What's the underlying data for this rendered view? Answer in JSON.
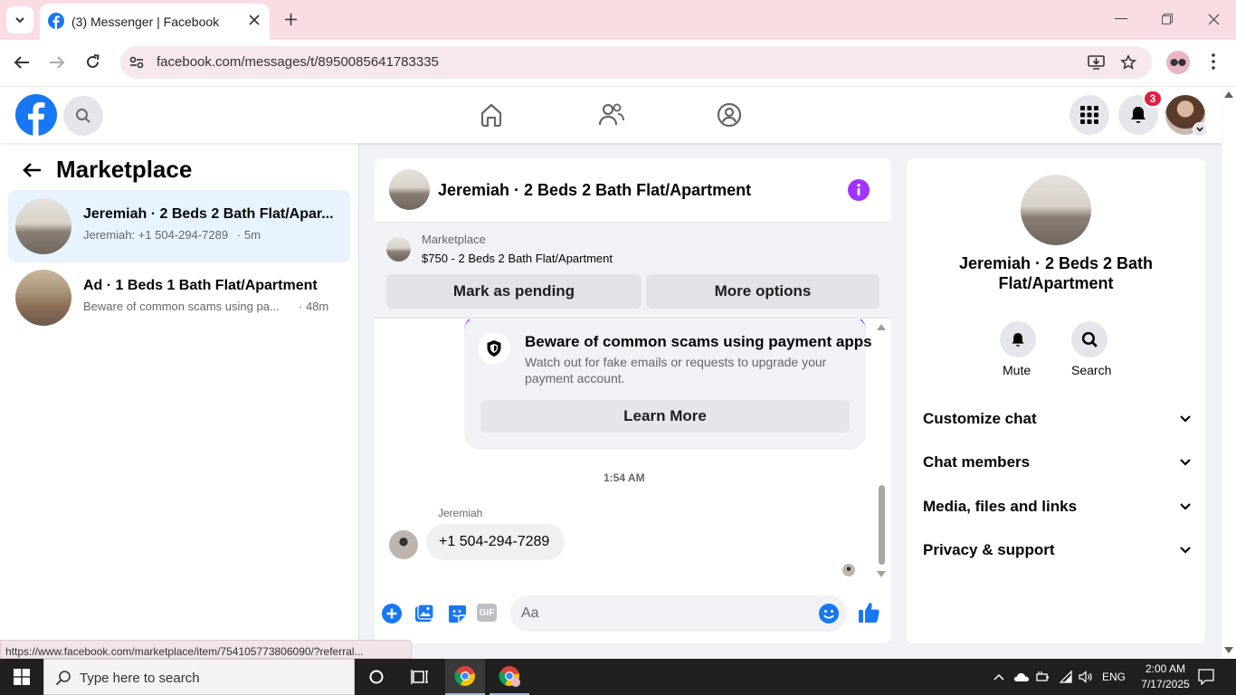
{
  "browser": {
    "tab_title": "(3) Messenger | Facebook",
    "url": "facebook.com/messages/t/8950085641783335",
    "status_url": "https://www.facebook.com/marketplace/item/754105773806090/?referral..."
  },
  "fb_header": {
    "notification_count": "3"
  },
  "sidebar": {
    "title": "Marketplace",
    "conversations": [
      {
        "title": "Jeremiah · 2 Beds 2 Bath Flat/Apar...",
        "preview": "Jeremiah: +1 504-294-7289",
        "time": "· 5m",
        "active": true
      },
      {
        "title": "Ad · 1 Beds 1 Bath Flat/Apartment",
        "preview": "Beware of common scams using pa...",
        "time": "· 48m",
        "active": false
      }
    ]
  },
  "chat": {
    "header_title": "Jeremiah · 2 Beds 2 Bath Flat/Apartment",
    "listing_source": "Marketplace",
    "listing_desc": "$750 - 2 Beds 2 Bath Flat/Apartment",
    "mark_pending_label": "Mark as pending",
    "more_options_label": "More options",
    "scam_card": {
      "title": "Beware of common scams using payment apps",
      "body": "Watch out for fake emails or requests to upgrade your payment account.",
      "button": "Learn More"
    },
    "timestamp": "1:54 AM",
    "message": {
      "sender": "Jeremiah",
      "text": "+1 504-294-7289"
    },
    "composer_placeholder": "Aa",
    "gif_label": "GIF"
  },
  "info": {
    "name": "Jeremiah · 2 Beds 2 Bath Flat/Apartment",
    "mute_label": "Mute",
    "search_label": "Search",
    "sections": [
      "Customize chat",
      "Chat members",
      "Media, files and links",
      "Privacy & support"
    ]
  },
  "taskbar": {
    "search_placeholder": "Type here to search",
    "language": "ENG",
    "time": "2:00 AM",
    "date": "7/17/2025"
  },
  "colors": {
    "fb_blue": "#1877f2",
    "messenger_purple": "#a033ff",
    "badge_red": "#e41e3f",
    "tab_strip": "#f9dde3"
  }
}
